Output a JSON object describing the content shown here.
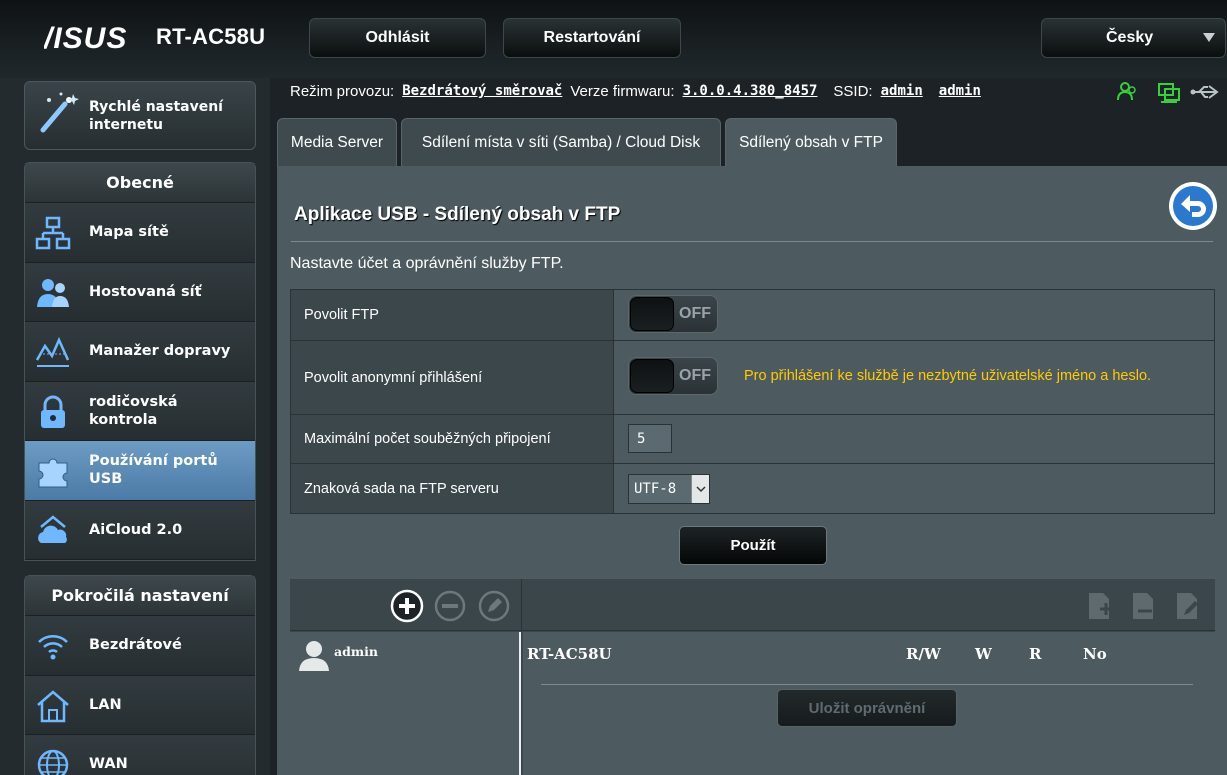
{
  "header": {
    "brand": "ASUS",
    "model": "RT-AC58U",
    "logout_label": "Odhlásit",
    "restart_label": "Restartování",
    "language": "Česky"
  },
  "sidebar": {
    "quick_setup": "Rychlé nastavení internetu",
    "general_title": "Obecné",
    "general_items": [
      {
        "label": "Mapa sítě",
        "icon": "network-map-icon"
      },
      {
        "label": "Hostovaná síť",
        "icon": "guest-network-icon"
      },
      {
        "label": "Manažer dopravy",
        "icon": "traffic-manager-icon"
      },
      {
        "label": "rodičovská kontrola",
        "icon": "parental-control-icon"
      },
      {
        "label": "Používání portů USB",
        "icon": "usb-application-icon",
        "active": true
      },
      {
        "label": "AiCloud 2.0",
        "icon": "aicloud-icon"
      }
    ],
    "advanced_title": "Pokročilá nastavení",
    "advanced_items": [
      {
        "label": "Bezdrátové",
        "icon": "wireless-icon"
      },
      {
        "label": "LAN",
        "icon": "lan-icon"
      },
      {
        "label": "WAN",
        "icon": "wan-icon"
      }
    ]
  },
  "status": {
    "mode_label": "Režim provozu:",
    "mode_value": "Bezdrátový směrovač",
    "fw_label": "Verze firmwaru:",
    "fw_value": "3.0.0.4.380_8457",
    "ssid_label": "SSID:",
    "ssid_1": "admin",
    "ssid_2": "admin"
  },
  "tabs": [
    "Media Server",
    "Sdílení místa v síti (Samba) / Cloud Disk",
    "Sdílený obsah v FTP"
  ],
  "main": {
    "title": "Aplikace USB - Sdílený obsah v FTP",
    "description": "Nastavte účet a oprávnění služby FTP.",
    "settings": {
      "enable_ftp_label": "Povolit FTP",
      "enable_ftp_value": "OFF",
      "anon_label": "Povolit anonymní přihlášení",
      "anon_value": "OFF",
      "anon_hint": "Pro přihlášení ke službě je nezbytné uživatelské jméno a heslo.",
      "max_conn_label": "Maximální počet souběžných připojení",
      "max_conn_value": "5",
      "charset_label": "Znaková sada na FTP serveru",
      "charset_value": "UTF-8"
    },
    "apply_label": "Použít"
  },
  "permissions": {
    "user": "admin",
    "device": "RT-AC58U",
    "columns": [
      "R/W",
      "W",
      "R",
      "No"
    ],
    "save_label": "Uložit oprávnění"
  },
  "colors": {
    "accent_active": "#5a8ab5",
    "hint": "#ffcc00",
    "status_green": "#35d13a"
  }
}
